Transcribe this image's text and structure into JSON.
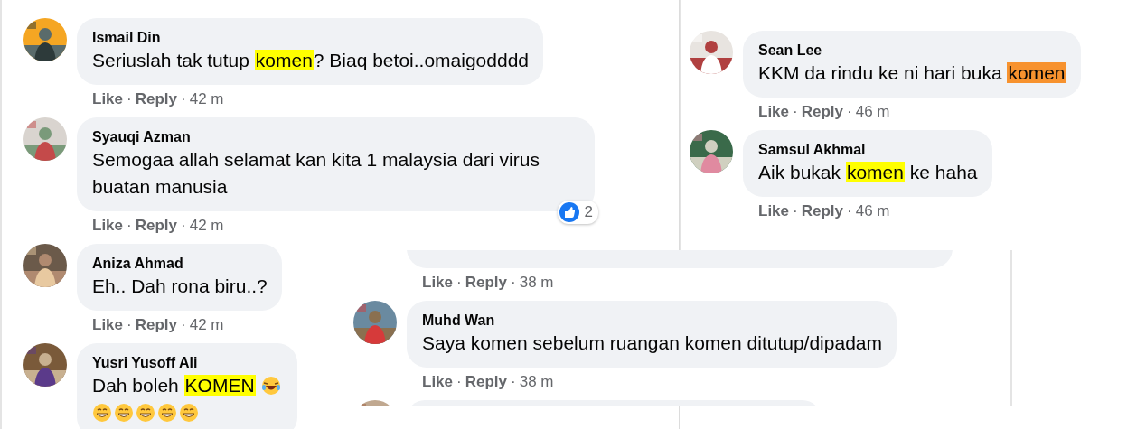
{
  "panels": [
    {
      "comments": [
        {
          "kind": "comment",
          "author": "Ismail Din",
          "message": [
            {
              "text": "Seriuslah tak tutup "
            },
            {
              "text": "komen",
              "color": "#ffff00"
            },
            {
              "text": "? Biaq betoi..omaigodddd"
            }
          ],
          "meta": {
            "like": "Like",
            "sep": "·",
            "reply": "Reply",
            "time": "42 m"
          }
        },
        {
          "kind": "comment",
          "author": "Syauqi Azman",
          "message": [
            {
              "text": "Semogaa allah selamat kan kita 1 malaysia dari virus buatan manusia"
            }
          ],
          "reactions": {
            "count": "2"
          },
          "meta": {
            "like": "Like",
            "sep": "·",
            "reply": "Reply",
            "time": "42 m"
          }
        },
        {
          "kind": "comment",
          "author": "Aniza Ahmad",
          "message": [
            {
              "text": "Eh.. Dah rona biru..?"
            }
          ],
          "meta": {
            "like": "Like",
            "sep": "·",
            "reply": "Reply",
            "time": "42 m"
          }
        },
        {
          "kind": "comment",
          "author": "Yusri Yusoff Ali",
          "message": [
            {
              "text": "Dah boleh "
            },
            {
              "text": "KOMEN",
              "color": "#ffff00"
            },
            {
              "kind": "laugh-emoji"
            },
            {
              "kind": "break"
            },
            {
              "kind": "grin-emoji"
            },
            {
              "kind": "grin-emoji"
            },
            {
              "kind": "grin-emoji"
            },
            {
              "kind": "grin-emoji"
            },
            {
              "kind": "grin-emoji"
            }
          ]
        }
      ]
    },
    {
      "comments": [
        {
          "kind": "comment",
          "author": "Sean Lee",
          "message": [
            {
              "text": "KKM da rindu ke ni hari buka "
            },
            {
              "text": "komen",
              "color": "#f7922e"
            }
          ],
          "meta": {
            "like": "Like",
            "sep": "·",
            "reply": "Reply",
            "time": "46 m"
          }
        },
        {
          "kind": "comment",
          "author": "Samsul Akhmal",
          "message": [
            {
              "text": "Aik bukak "
            },
            {
              "text": "komen",
              "color": "#ffff00"
            },
            {
              "text": " ke haha"
            }
          ],
          "meta": {
            "like": "Like",
            "sep": "·",
            "reply": "Reply",
            "time": "46 m"
          }
        }
      ]
    },
    {
      "comments": [
        {
          "kind": "cut-top",
          "meta": {
            "like": "Like",
            "sep": "·",
            "reply": "Reply",
            "time": "38 m"
          }
        },
        {
          "kind": "comment",
          "author": "Muhd Wan",
          "message": [
            {
              "text": "Saya komen sebelum ruangan komen ditutup/dipadam"
            }
          ],
          "meta": {
            "like": "Like",
            "sep": "·",
            "reply": "Reply",
            "time": "38 m"
          }
        },
        {
          "kind": "cut-bottom"
        }
      ]
    }
  ]
}
